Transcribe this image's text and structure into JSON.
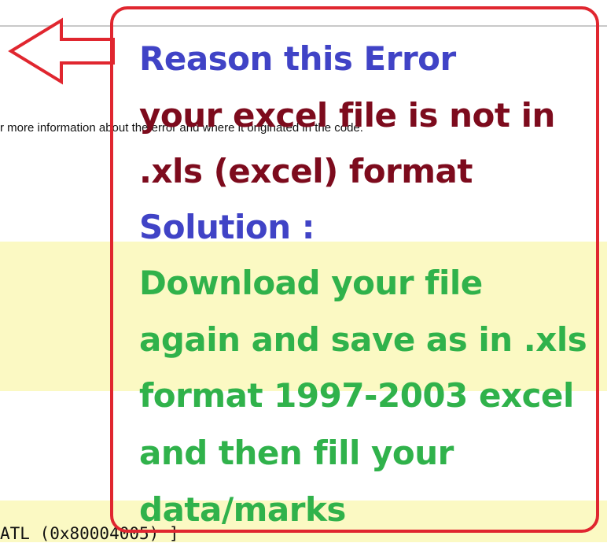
{
  "background": {
    "info_text": "r more information about the error and where it originated in the code.",
    "code_text": "ATL (0x80004005) ]"
  },
  "annotation": {
    "reason_heading": "Reason this Error",
    "reason_line1": "your excel file is not in",
    "reason_line2": ".xls (excel) format",
    "solution_heading": "Solution :",
    "solution_line1": "Download your file",
    "solution_line2": "again and save as in .xls",
    "solution_line3": "format 1997-2003 excel",
    "solution_line4": "and then fill your",
    "solution_line5": "data/marks"
  },
  "colors": {
    "border_red": "#e0262f",
    "heading_blue": "#4043c6",
    "reason_maroon": "#7d0b1d",
    "solution_green": "#30b24b",
    "highlight_yellow": "#fbf9c3"
  },
  "icons": {
    "arrow": "left-arrow-icon"
  }
}
